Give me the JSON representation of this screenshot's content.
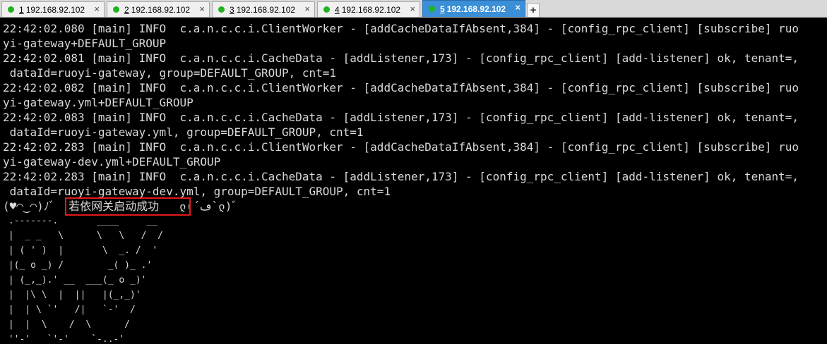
{
  "tabs": [
    {
      "num": "1",
      "host": "192.168.92.102"
    },
    {
      "num": "2",
      "host": "192.168.92.102"
    },
    {
      "num": "3",
      "host": "192.168.92.102"
    },
    {
      "num": "4",
      "host": "192.168.92.102"
    },
    {
      "num": "5",
      "host": "192.168.92.102"
    }
  ],
  "tab_close": "×",
  "tab_add": "+",
  "colors": {
    "active_tab": "#3a8fd6",
    "status_dot": "#21b321",
    "highlight": "#e0181c",
    "terminal_bg": "#000000",
    "terminal_fg": "#d8d8d8"
  },
  "log_lines": [
    "22:42:02.080 [main] INFO  c.a.n.c.c.i.ClientWorker - [addCacheDataIfAbsent,384] - [config_rpc_client] [subscribe] ruo",
    "yi-gateway+DEFAULT_GROUP",
    "22:42:02.081 [main] INFO  c.a.n.c.c.i.CacheData - [addListener,173] - [config_rpc_client] [add-listener] ok, tenant=,",
    " dataId=ruoyi-gateway, group=DEFAULT_GROUP, cnt=1",
    "22:42:02.082 [main] INFO  c.a.n.c.c.i.ClientWorker - [addCacheDataIfAbsent,384] - [config_rpc_client] [subscribe] ruo",
    "yi-gateway.yml+DEFAULT_GROUP",
    "22:42:02.083 [main] INFO  c.a.n.c.c.i.CacheData - [addListener,173] - [config_rpc_client] [add-listener] ok, tenant=,",
    " dataId=ruoyi-gateway.yml, group=DEFAULT_GROUP, cnt=1",
    "22:42:02.283 [main] INFO  c.a.n.c.c.i.ClientWorker - [addCacheDataIfAbsent,384] - [config_rpc_client] [subscribe] ruo",
    "yi-gateway-dev.yml+DEFAULT_GROUP",
    "22:42:02.283 [main] INFO  c.a.n.c.c.i.CacheData - [addListener,173] - [config_rpc_client] [add-listener] ok, tenant=,",
    " dataId=ruoyi-gateway-dev.yml, group=DEFAULT_GROUP, cnt=1"
  ],
  "startup_message": "(♥◠‿◠)ﾉﾞ  若依网关启动成功   ლ(´ڡ`ლ)ﾞ",
  "ascii_art": [
    " .-------.       ____     __",
    " |  _ _   \\      \\   \\   /  /",
    " | ( ' )  |       \\  _. /  '",
    " |(_ o _) /        _( )_ .'",
    " | (_,_).' __  ___(_ o _)'",
    " |  |\\ \\  |  ||   |(_,_)'",
    " |  | \\ `'   /|   `-'  /",
    " |  |  \\    /  \\      /",
    " ''-'   `'-'    `-..-'"
  ]
}
